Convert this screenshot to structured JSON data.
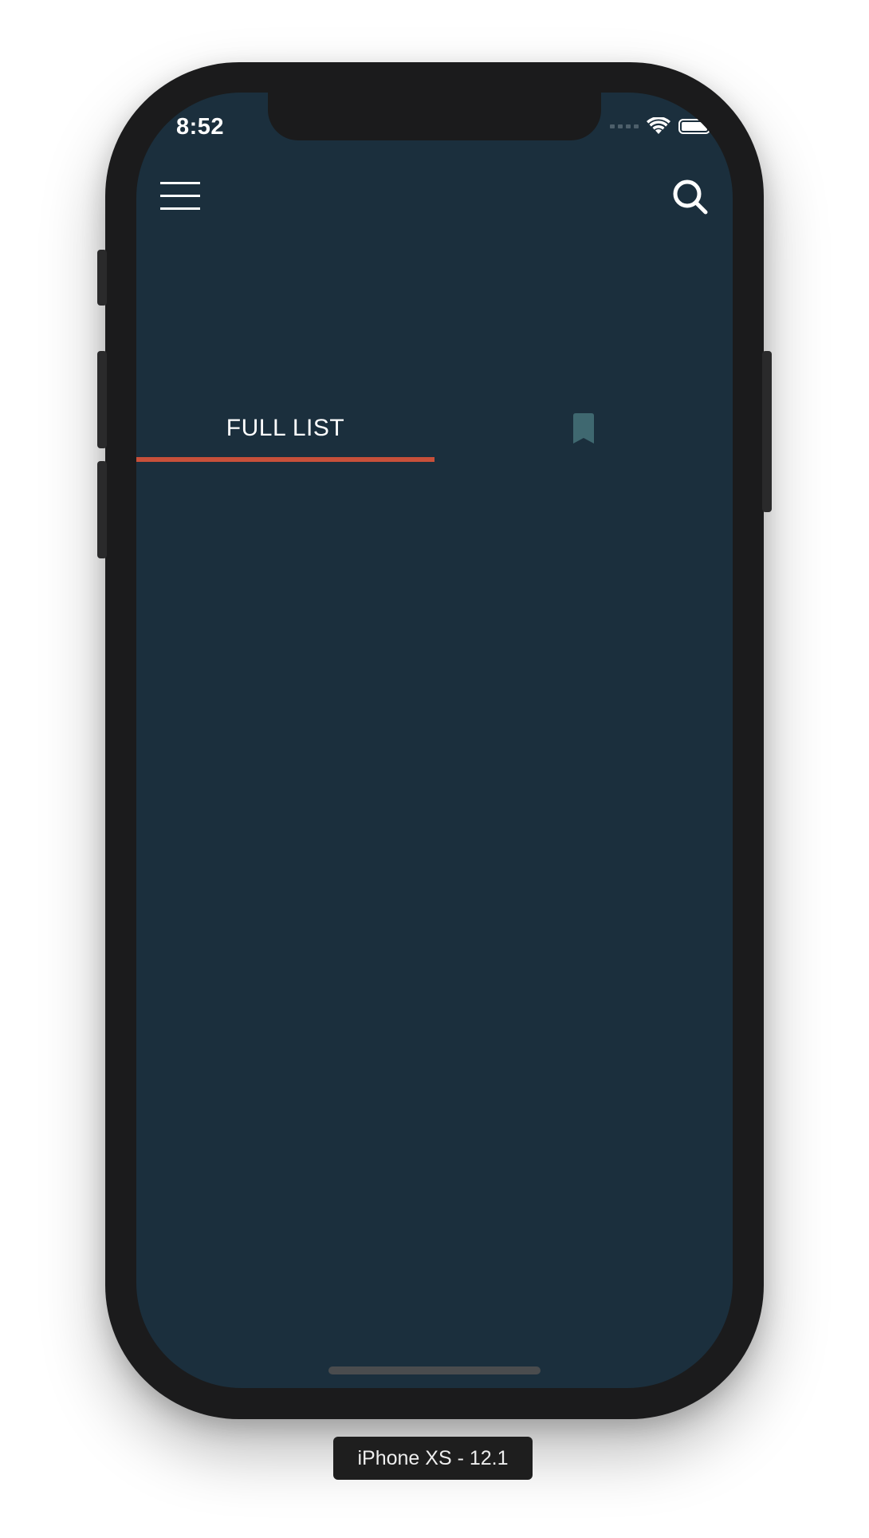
{
  "status_bar": {
    "time": "8:52",
    "icons": [
      "signal-icon",
      "wifi-icon",
      "battery-icon"
    ]
  },
  "header": {
    "menu_icon": "hamburger-menu-icon",
    "search_icon": "search-icon"
  },
  "tabs": [
    {
      "label": "FULL LIST",
      "selected": true
    },
    {
      "icon": "bookmark-icon",
      "selected": false
    }
  ],
  "device_label": "iPhone XS - 12.1",
  "colors": {
    "screen_background": "#1b2f3d",
    "tab_indicator": "#c8503a",
    "bookmark_icon": "#3f6870",
    "device_frame": "#1b1b1c"
  }
}
